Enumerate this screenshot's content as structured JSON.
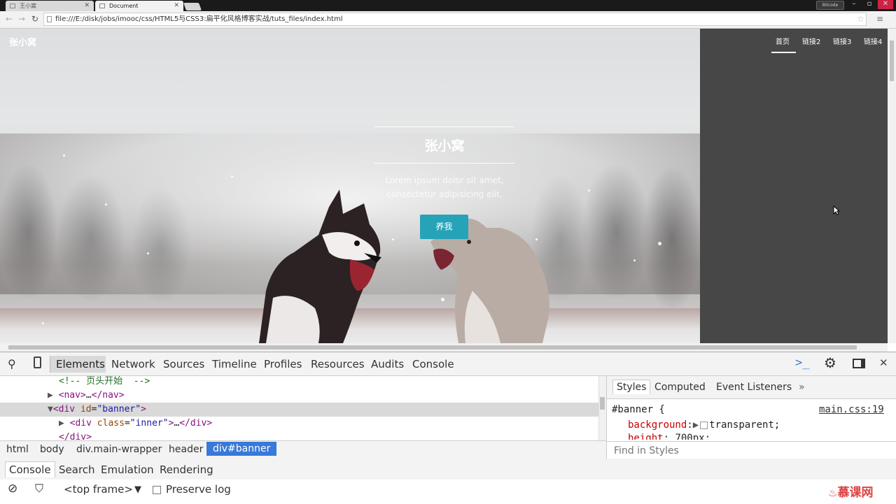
{
  "browser": {
    "tabs": [
      {
        "title": "王小窝",
        "active": false
      },
      {
        "title": "Document",
        "active": true
      }
    ],
    "window_badge": "Bitcode",
    "address": "file:///E:/disk/jobs/imooc/css/HTML5与CSS3:扁平化风格博客实战/tuts_files/index.html"
  },
  "page": {
    "brand": "张小窝",
    "hero_title": "张小窝",
    "hero_subtitle_line1": "Lorem ipsum dolor sit amet,",
    "hero_subtitle_line2": "consectetur adipisicing elit.",
    "cta_label": "养我",
    "cta_color": "#26a3b8",
    "side_nav_bg": "#474747",
    "nav": [
      "首页",
      "链接2",
      "链接3",
      "链接4"
    ],
    "nav_active": "首页"
  },
  "devtools": {
    "tabs": [
      "Elements",
      "Network",
      "Sources",
      "Timeline",
      "Profiles",
      "Resources",
      "Audits",
      "Console"
    ],
    "active_tab": "Elements",
    "dom_lines": {
      "comment": "<!-- 页头开始  -->",
      "nav_open": "<nav>",
      "nav_ellipsis": "…",
      "nav_close": "</nav>",
      "div_tag": "div",
      "attr_id": "id",
      "attr_id_value": "\"banner\"",
      "div_class": "class",
      "div_class_value": "\"inner\"",
      "inner_ellipsis": "…",
      "div_close": "</div>"
    },
    "breadcrumbs": [
      "html",
      "body",
      "div.main-wrapper",
      "header",
      "div#banner"
    ],
    "styles_tabs": [
      "Styles",
      "Computed",
      "Event Listeners"
    ],
    "rule_selector": "#banner {",
    "rule_source": "main.css:19",
    "props": [
      {
        "name": "background",
        "value": "transparent;"
      },
      {
        "name": "height",
        "value": "700px;"
      }
    ],
    "find_placeholder": "Find in Styles",
    "drawer_tabs": [
      "Console",
      "Search",
      "Emulation",
      "Rendering"
    ],
    "console_frame": "<top frame>",
    "preserve_log": "Preserve log"
  },
  "watermark": "慕课网"
}
